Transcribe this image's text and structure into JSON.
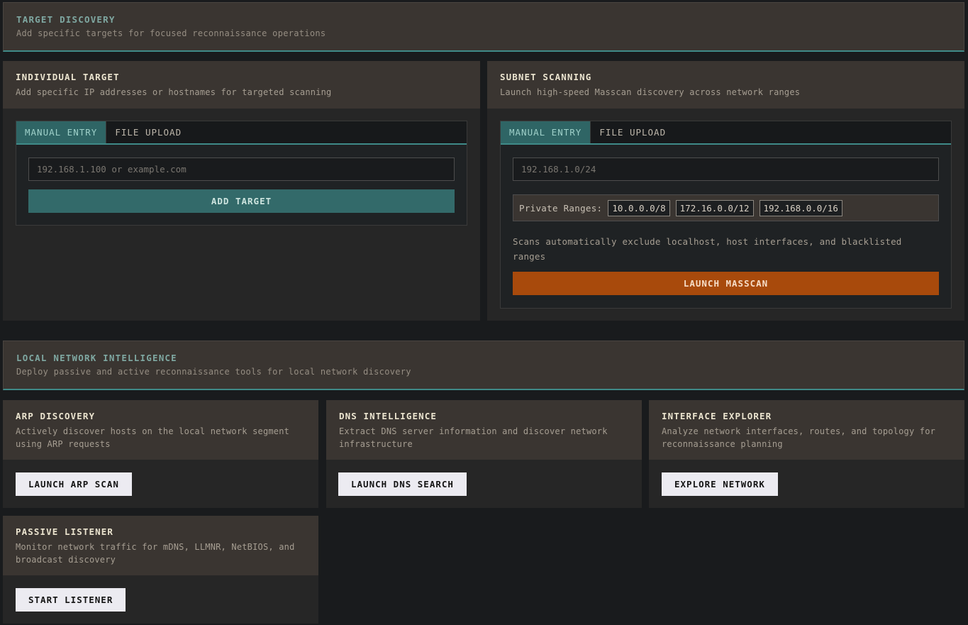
{
  "target_discovery": {
    "title": "TARGET DISCOVERY",
    "subtitle": "Add specific targets for focused reconnaissance operations"
  },
  "individual_target": {
    "title": "INDIVIDUAL TARGET",
    "subtitle": "Add specific IP addresses or hostnames for targeted scanning",
    "tabs": [
      {
        "label": "MANUAL ENTRY",
        "active": true
      },
      {
        "label": "FILE UPLOAD",
        "active": false
      }
    ],
    "input_placeholder": "192.168.1.100 or example.com",
    "input_value": "",
    "button_label": "ADD TARGET"
  },
  "subnet_scanning": {
    "title": "SUBNET SCANNING",
    "subtitle": "Launch high-speed Masscan discovery across network ranges",
    "tabs": [
      {
        "label": "MANUAL ENTRY",
        "active": true
      },
      {
        "label": "FILE UPLOAD",
        "active": false
      }
    ],
    "input_placeholder": "192.168.1.0/24",
    "input_value": "",
    "ranges_label": "Private Ranges:",
    "ranges": [
      "10.0.0.0/8",
      "172.16.0.0/12",
      "192.168.0.0/16"
    ],
    "note": "Scans automatically exclude localhost, host interfaces, and blacklisted ranges",
    "button_label": "LAUNCH MASSCAN"
  },
  "local_network": {
    "title": "LOCAL NETWORK INTELLIGENCE",
    "subtitle": "Deploy passive and active reconnaissance tools for local network discovery"
  },
  "tools": [
    {
      "title": "ARP DISCOVERY",
      "desc": "Actively discover hosts on the local network segment using ARP requests",
      "button": "LAUNCH ARP SCAN"
    },
    {
      "title": "DNS INTELLIGENCE",
      "desc": "Extract DNS server information and discover network infrastructure",
      "button": "LAUNCH DNS SEARCH"
    },
    {
      "title": "INTERFACE EXPLORER",
      "desc": "Analyze network interfaces, routes, and topology for reconnaissance planning",
      "button": "EXPLORE NETWORK"
    },
    {
      "title": "PASSIVE LISTENER",
      "desc": "Monitor network traffic for mDNS, LLMNR, NetBIOS, and broadcast discovery",
      "button": "START LISTENER"
    }
  ],
  "colors": {
    "accent": "#3f8a88",
    "teal_button": "#336a6a",
    "orange_button": "#a84a0c",
    "card_header": "#3a3531"
  }
}
